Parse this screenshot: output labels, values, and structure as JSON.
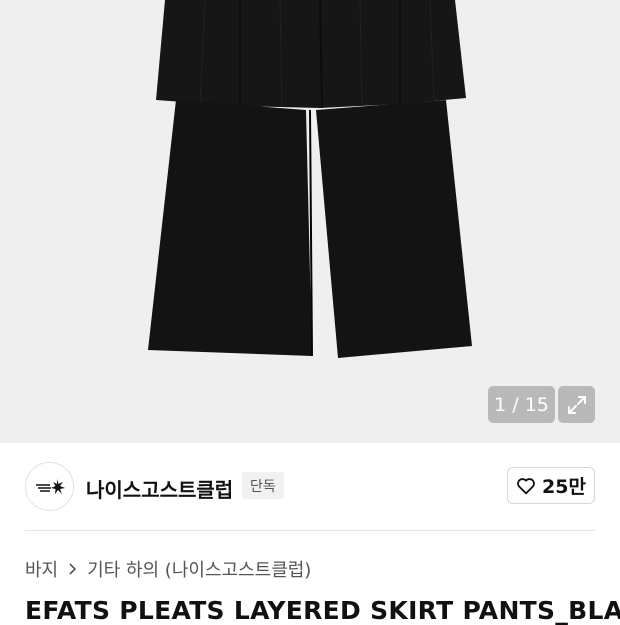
{
  "gallery": {
    "counter": "1 / 15",
    "expand_icon": "expand-icon"
  },
  "brand": {
    "logo_icon": "brand-logo-icon",
    "name": "나이스고스트클럽",
    "tag": "단독",
    "like_icon": "heart-icon",
    "like_count": "25만"
  },
  "breadcrumb": {
    "category": "바지",
    "separator_icon": "chevron-right-icon",
    "subcategory": "기타 하의 (나이스고스트클럽)"
  },
  "product": {
    "title": "EFATS PLEATS LAYERED SKIRT PANTS_BLAC"
  },
  "colors": {
    "hero_bg": "#efefef",
    "garment": "#141414",
    "accent_text": "#111111",
    "muted_text": "#555555"
  }
}
